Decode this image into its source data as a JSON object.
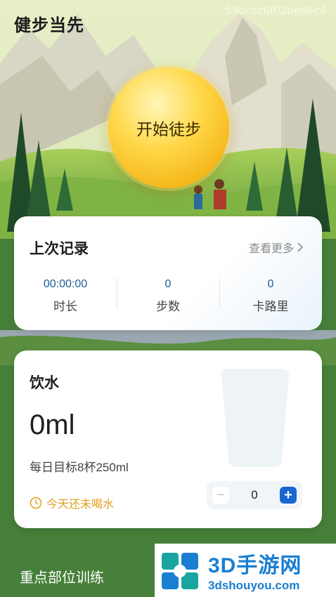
{
  "app": {
    "title": "健步当先",
    "watermark": "59bcac6f02be66c4"
  },
  "start_button": {
    "label": "开始徒步"
  },
  "last_record": {
    "title": "上次记录",
    "more_label": "查看更多",
    "stats": [
      {
        "value": "00:00:00",
        "label": "时长"
      },
      {
        "value": "0",
        "label": "步数"
      },
      {
        "value": "0",
        "label": "卡路里"
      }
    ]
  },
  "water": {
    "title": "饮水",
    "amount": "0ml",
    "goal": "每日目标8杯250ml",
    "warning": "今天还未喝水",
    "cups": "0"
  },
  "section": {
    "title": "重点部位训练"
  },
  "promo": {
    "main": "3D手游网",
    "sub": "3dshouyou.com"
  },
  "colors": {
    "accent": "#1a66d1",
    "warning": "#e2a020",
    "stat_value": "#1f5c99"
  }
}
